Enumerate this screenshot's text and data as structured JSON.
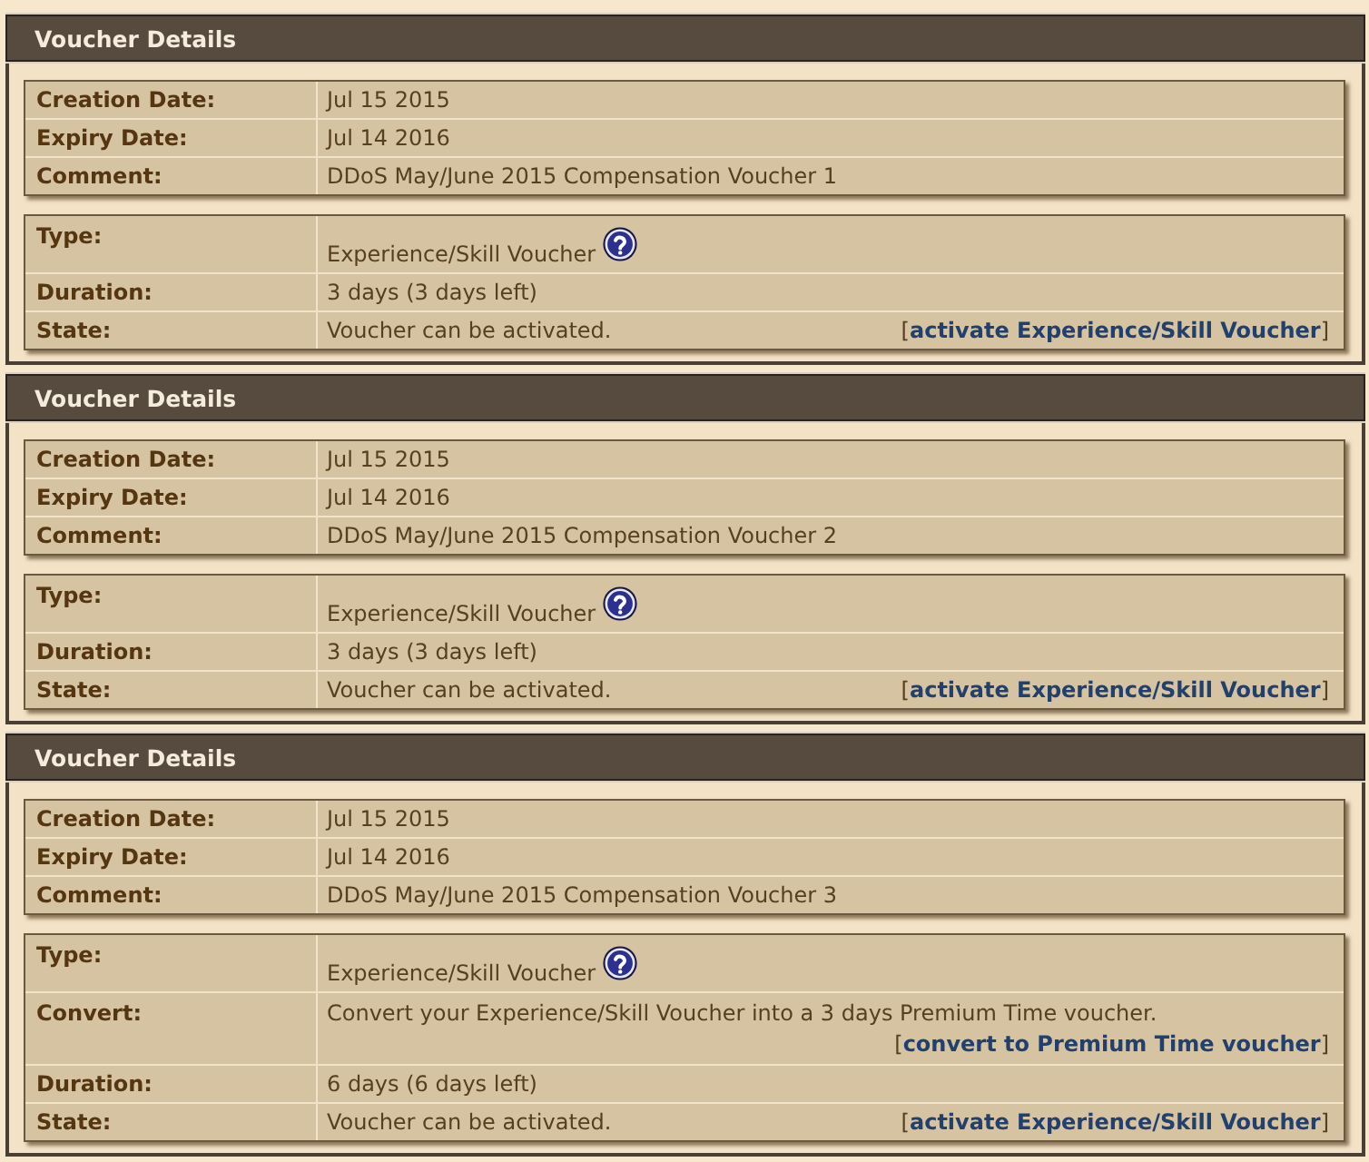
{
  "sections": [
    {
      "title": "Voucher Details",
      "details": [
        {
          "kind": "plain",
          "label": "Creation Date:",
          "value": "Jul 15 2015"
        },
        {
          "kind": "plain",
          "label": "Expiry Date:",
          "value": "Jul 14 2016"
        },
        {
          "kind": "plain",
          "label": "Comment:",
          "value": "DDoS May/June 2015 Compensation Voucher 1"
        }
      ],
      "voucher": [
        {
          "kind": "info",
          "label": "Type:",
          "value": "Experience/Skill Voucher"
        },
        {
          "kind": "plain",
          "label": "Duration:",
          "value": "3 days (3 days left)"
        },
        {
          "kind": "action",
          "label": "State:",
          "value": "Voucher can be activated.",
          "link": {
            "open": "[",
            "text": "activate Experience/Skill Voucher",
            "close": "]"
          }
        }
      ]
    },
    {
      "title": "Voucher Details",
      "details": [
        {
          "kind": "plain",
          "label": "Creation Date:",
          "value": "Jul 15 2015"
        },
        {
          "kind": "plain",
          "label": "Expiry Date:",
          "value": "Jul 14 2016"
        },
        {
          "kind": "plain",
          "label": "Comment:",
          "value": "DDoS May/June 2015 Compensation Voucher 2"
        }
      ],
      "voucher": [
        {
          "kind": "info",
          "label": "Type:",
          "value": "Experience/Skill Voucher"
        },
        {
          "kind": "plain",
          "label": "Duration:",
          "value": "3 days (3 days left)"
        },
        {
          "kind": "action",
          "label": "State:",
          "value": "Voucher can be activated.",
          "link": {
            "open": "[",
            "text": "activate Experience/Skill Voucher",
            "close": "]"
          }
        }
      ]
    },
    {
      "title": "Voucher Details",
      "details": [
        {
          "kind": "plain",
          "label": "Creation Date:",
          "value": "Jul 15 2015"
        },
        {
          "kind": "plain",
          "label": "Expiry Date:",
          "value": "Jul 14 2016"
        },
        {
          "kind": "plain",
          "label": "Comment:",
          "value": "DDoS May/June 2015 Compensation Voucher 3"
        }
      ],
      "voucher": [
        {
          "kind": "info",
          "label": "Type:",
          "value": "Experience/Skill Voucher"
        },
        {
          "kind": "offer",
          "label": "Convert:",
          "value": "Convert your Experience/Skill Voucher into a 3 days Premium Time voucher.",
          "link": {
            "open": "[",
            "text": "convert to Premium Time voucher",
            "close": "]"
          }
        },
        {
          "kind": "plain",
          "label": "Duration:",
          "value": "6 days (6 days left)"
        },
        {
          "kind": "action",
          "label": "State:",
          "value": "Voucher can be activated.",
          "link": {
            "open": "[",
            "text": "activate Experience/Skill Voucher",
            "close": "]"
          }
        }
      ]
    }
  ]
}
